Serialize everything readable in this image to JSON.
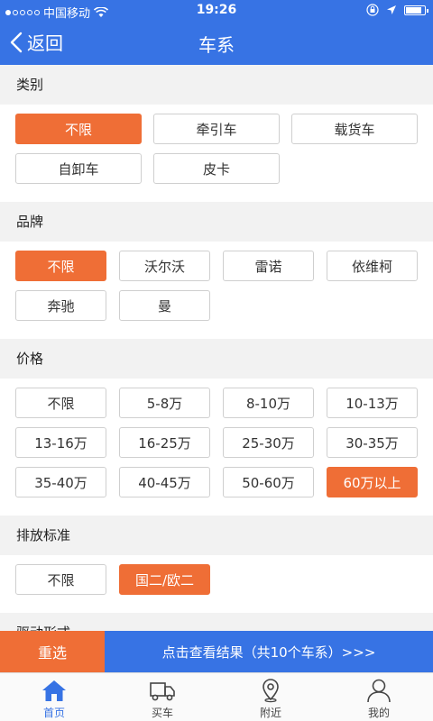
{
  "status": {
    "carrier": "中国移动",
    "time": "19:26",
    "battery_level": 0.85
  },
  "nav": {
    "back_label": "返回",
    "title": "车系"
  },
  "sections": {
    "category": {
      "title": "类别",
      "options": [
        "不限",
        "牵引车",
        "载货车",
        "自卸车",
        "皮卡"
      ],
      "selected": 0
    },
    "brand": {
      "title": "品牌",
      "options": [
        "不限",
        "沃尔沃",
        "雷诺",
        "依维柯",
        "奔驰",
        "曼"
      ],
      "selected": 0
    },
    "price": {
      "title": "价格",
      "options": [
        "不限",
        "5-8万",
        "8-10万",
        "10-13万",
        "13-16万",
        "16-25万",
        "25-30万",
        "30-35万",
        "35-40万",
        "40-45万",
        "50-60万",
        "60万以上"
      ],
      "selected": 11
    },
    "emission": {
      "title": "排放标准",
      "options": [
        "不限",
        "国二/欧二"
      ],
      "selected": 1
    },
    "drive": {
      "title": "驱动形式"
    }
  },
  "actions": {
    "reset_label": "重选",
    "result_label": "点击查看结果（共10个车系）>>>"
  },
  "tabs": [
    {
      "label": "首页",
      "icon": "home-icon",
      "active": true
    },
    {
      "label": "买车",
      "icon": "truck-icon",
      "active": false
    },
    {
      "label": "附近",
      "icon": "location-pin-icon",
      "active": false
    },
    {
      "label": "我的",
      "icon": "user-icon",
      "active": false
    }
  ],
  "colors": {
    "primary": "#3773e4",
    "accent": "#ef6e36",
    "section_bg": "#f2f2f2"
  }
}
